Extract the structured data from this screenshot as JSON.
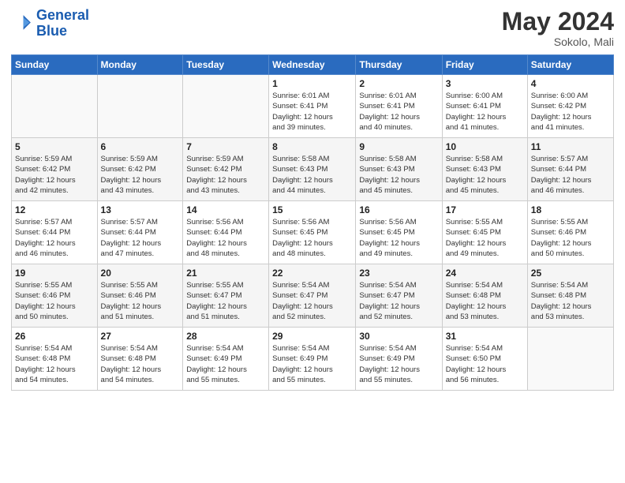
{
  "logo": {
    "line1": "General",
    "line2": "Blue"
  },
  "header": {
    "month_year": "May 2024",
    "location": "Sokolo, Mali"
  },
  "days_of_week": [
    "Sunday",
    "Monday",
    "Tuesday",
    "Wednesday",
    "Thursday",
    "Friday",
    "Saturday"
  ],
  "weeks": [
    [
      {
        "date": "",
        "info": ""
      },
      {
        "date": "",
        "info": ""
      },
      {
        "date": "",
        "info": ""
      },
      {
        "date": "1",
        "info": "Sunrise: 6:01 AM\nSunset: 6:41 PM\nDaylight: 12 hours\nand 39 minutes."
      },
      {
        "date": "2",
        "info": "Sunrise: 6:01 AM\nSunset: 6:41 PM\nDaylight: 12 hours\nand 40 minutes."
      },
      {
        "date": "3",
        "info": "Sunrise: 6:00 AM\nSunset: 6:41 PM\nDaylight: 12 hours\nand 41 minutes."
      },
      {
        "date": "4",
        "info": "Sunrise: 6:00 AM\nSunset: 6:42 PM\nDaylight: 12 hours\nand 41 minutes."
      }
    ],
    [
      {
        "date": "5",
        "info": "Sunrise: 5:59 AM\nSunset: 6:42 PM\nDaylight: 12 hours\nand 42 minutes."
      },
      {
        "date": "6",
        "info": "Sunrise: 5:59 AM\nSunset: 6:42 PM\nDaylight: 12 hours\nand 43 minutes."
      },
      {
        "date": "7",
        "info": "Sunrise: 5:59 AM\nSunset: 6:42 PM\nDaylight: 12 hours\nand 43 minutes."
      },
      {
        "date": "8",
        "info": "Sunrise: 5:58 AM\nSunset: 6:43 PM\nDaylight: 12 hours\nand 44 minutes."
      },
      {
        "date": "9",
        "info": "Sunrise: 5:58 AM\nSunset: 6:43 PM\nDaylight: 12 hours\nand 45 minutes."
      },
      {
        "date": "10",
        "info": "Sunrise: 5:58 AM\nSunset: 6:43 PM\nDaylight: 12 hours\nand 45 minutes."
      },
      {
        "date": "11",
        "info": "Sunrise: 5:57 AM\nSunset: 6:44 PM\nDaylight: 12 hours\nand 46 minutes."
      }
    ],
    [
      {
        "date": "12",
        "info": "Sunrise: 5:57 AM\nSunset: 6:44 PM\nDaylight: 12 hours\nand 46 minutes."
      },
      {
        "date": "13",
        "info": "Sunrise: 5:57 AM\nSunset: 6:44 PM\nDaylight: 12 hours\nand 47 minutes."
      },
      {
        "date": "14",
        "info": "Sunrise: 5:56 AM\nSunset: 6:44 PM\nDaylight: 12 hours\nand 48 minutes."
      },
      {
        "date": "15",
        "info": "Sunrise: 5:56 AM\nSunset: 6:45 PM\nDaylight: 12 hours\nand 48 minutes."
      },
      {
        "date": "16",
        "info": "Sunrise: 5:56 AM\nSunset: 6:45 PM\nDaylight: 12 hours\nand 49 minutes."
      },
      {
        "date": "17",
        "info": "Sunrise: 5:55 AM\nSunset: 6:45 PM\nDaylight: 12 hours\nand 49 minutes."
      },
      {
        "date": "18",
        "info": "Sunrise: 5:55 AM\nSunset: 6:46 PM\nDaylight: 12 hours\nand 50 minutes."
      }
    ],
    [
      {
        "date": "19",
        "info": "Sunrise: 5:55 AM\nSunset: 6:46 PM\nDaylight: 12 hours\nand 50 minutes."
      },
      {
        "date": "20",
        "info": "Sunrise: 5:55 AM\nSunset: 6:46 PM\nDaylight: 12 hours\nand 51 minutes."
      },
      {
        "date": "21",
        "info": "Sunrise: 5:55 AM\nSunset: 6:47 PM\nDaylight: 12 hours\nand 51 minutes."
      },
      {
        "date": "22",
        "info": "Sunrise: 5:54 AM\nSunset: 6:47 PM\nDaylight: 12 hours\nand 52 minutes."
      },
      {
        "date": "23",
        "info": "Sunrise: 5:54 AM\nSunset: 6:47 PM\nDaylight: 12 hours\nand 52 minutes."
      },
      {
        "date": "24",
        "info": "Sunrise: 5:54 AM\nSunset: 6:48 PM\nDaylight: 12 hours\nand 53 minutes."
      },
      {
        "date": "25",
        "info": "Sunrise: 5:54 AM\nSunset: 6:48 PM\nDaylight: 12 hours\nand 53 minutes."
      }
    ],
    [
      {
        "date": "26",
        "info": "Sunrise: 5:54 AM\nSunset: 6:48 PM\nDaylight: 12 hours\nand 54 minutes."
      },
      {
        "date": "27",
        "info": "Sunrise: 5:54 AM\nSunset: 6:48 PM\nDaylight: 12 hours\nand 54 minutes."
      },
      {
        "date": "28",
        "info": "Sunrise: 5:54 AM\nSunset: 6:49 PM\nDaylight: 12 hours\nand 55 minutes."
      },
      {
        "date": "29",
        "info": "Sunrise: 5:54 AM\nSunset: 6:49 PM\nDaylight: 12 hours\nand 55 minutes."
      },
      {
        "date": "30",
        "info": "Sunrise: 5:54 AM\nSunset: 6:49 PM\nDaylight: 12 hours\nand 55 minutes."
      },
      {
        "date": "31",
        "info": "Sunrise: 5:54 AM\nSunset: 6:50 PM\nDaylight: 12 hours\nand 56 minutes."
      },
      {
        "date": "",
        "info": ""
      }
    ]
  ]
}
